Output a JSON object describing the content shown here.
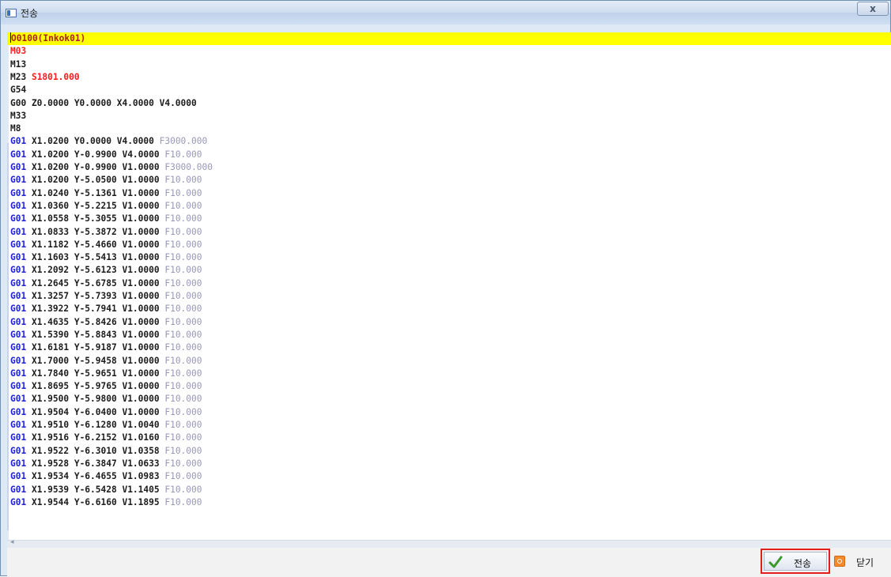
{
  "window": {
    "title": "전송",
    "close_glyph": "x"
  },
  "editor": {
    "lines": [
      [
        {
          "t": "O0100(Inkok01)",
          "c": "first"
        }
      ],
      [
        {
          "t": "M03",
          "c": "c-red"
        }
      ],
      [
        {
          "t": "M13",
          "c": "c-dark"
        }
      ],
      [
        {
          "t": "M23 ",
          "c": "c-dark"
        },
        {
          "t": "S1801.000",
          "c": "c-red"
        }
      ],
      [
        {
          "t": "G54",
          "c": "c-dark"
        }
      ],
      [
        {
          "t": "G00 Z0.0000 Y0.0000 X4.0000 V4.0000",
          "c": "c-dark"
        }
      ],
      [
        {
          "t": "M33",
          "c": "c-dark"
        }
      ],
      [
        {
          "t": "M8",
          "c": "c-dark"
        }
      ],
      [
        {
          "t": "G01",
          "c": "c-blue"
        },
        {
          "t": " X1.0200 Y0.0000 V4.0000 ",
          "c": "c-dark"
        },
        {
          "t": "F3000.000",
          "c": "c-feed"
        }
      ],
      [
        {
          "t": "G01",
          "c": "c-blue"
        },
        {
          "t": " X1.0200 Y-0.9900 V4.0000 ",
          "c": "c-dark"
        },
        {
          "t": "F10.000",
          "c": "c-feed"
        }
      ],
      [
        {
          "t": "G01",
          "c": "c-blue"
        },
        {
          "t": " X1.0200 Y-0.9900 V1.0000 ",
          "c": "c-dark"
        },
        {
          "t": "F3000.000",
          "c": "c-feed"
        }
      ],
      [
        {
          "t": "G01",
          "c": "c-blue"
        },
        {
          "t": " X1.0200 Y-5.0500 V1.0000 ",
          "c": "c-dark"
        },
        {
          "t": "F10.000",
          "c": "c-feed"
        }
      ],
      [
        {
          "t": "G01",
          "c": "c-blue"
        },
        {
          "t": " X1.0240 Y-5.1361 V1.0000 ",
          "c": "c-dark"
        },
        {
          "t": "F10.000",
          "c": "c-feed"
        }
      ],
      [
        {
          "t": "G01",
          "c": "c-blue"
        },
        {
          "t": " X1.0360 Y-5.2215 V1.0000 ",
          "c": "c-dark"
        },
        {
          "t": "F10.000",
          "c": "c-feed"
        }
      ],
      [
        {
          "t": "G01",
          "c": "c-blue"
        },
        {
          "t": " X1.0558 Y-5.3055 V1.0000 ",
          "c": "c-dark"
        },
        {
          "t": "F10.000",
          "c": "c-feed"
        }
      ],
      [
        {
          "t": "G01",
          "c": "c-blue"
        },
        {
          "t": " X1.0833 Y-5.3872 V1.0000 ",
          "c": "c-dark"
        },
        {
          "t": "F10.000",
          "c": "c-feed"
        }
      ],
      [
        {
          "t": "G01",
          "c": "c-blue"
        },
        {
          "t": " X1.1182 Y-5.4660 V1.0000 ",
          "c": "c-dark"
        },
        {
          "t": "F10.000",
          "c": "c-feed"
        }
      ],
      [
        {
          "t": "G01",
          "c": "c-blue"
        },
        {
          "t": " X1.1603 Y-5.5413 V1.0000 ",
          "c": "c-dark"
        },
        {
          "t": "F10.000",
          "c": "c-feed"
        }
      ],
      [
        {
          "t": "G01",
          "c": "c-blue"
        },
        {
          "t": " X1.2092 Y-5.6123 V1.0000 ",
          "c": "c-dark"
        },
        {
          "t": "F10.000",
          "c": "c-feed"
        }
      ],
      [
        {
          "t": "G01",
          "c": "c-blue"
        },
        {
          "t": " X1.2645 Y-5.6785 V1.0000 ",
          "c": "c-dark"
        },
        {
          "t": "F10.000",
          "c": "c-feed"
        }
      ],
      [
        {
          "t": "G01",
          "c": "c-blue"
        },
        {
          "t": " X1.3257 Y-5.7393 V1.0000 ",
          "c": "c-dark"
        },
        {
          "t": "F10.000",
          "c": "c-feed"
        }
      ],
      [
        {
          "t": "G01",
          "c": "c-blue"
        },
        {
          "t": " X1.3922 Y-5.7941 V1.0000 ",
          "c": "c-dark"
        },
        {
          "t": "F10.000",
          "c": "c-feed"
        }
      ],
      [
        {
          "t": "G01",
          "c": "c-blue"
        },
        {
          "t": " X1.4635 Y-5.8426 V1.0000 ",
          "c": "c-dark"
        },
        {
          "t": "F10.000",
          "c": "c-feed"
        }
      ],
      [
        {
          "t": "G01",
          "c": "c-blue"
        },
        {
          "t": " X1.5390 Y-5.8843 V1.0000 ",
          "c": "c-dark"
        },
        {
          "t": "F10.000",
          "c": "c-feed"
        }
      ],
      [
        {
          "t": "G01",
          "c": "c-blue"
        },
        {
          "t": " X1.6181 Y-5.9187 V1.0000 ",
          "c": "c-dark"
        },
        {
          "t": "F10.000",
          "c": "c-feed"
        }
      ],
      [
        {
          "t": "G01",
          "c": "c-blue"
        },
        {
          "t": " X1.7000 Y-5.9458 V1.0000 ",
          "c": "c-dark"
        },
        {
          "t": "F10.000",
          "c": "c-feed"
        }
      ],
      [
        {
          "t": "G01",
          "c": "c-blue"
        },
        {
          "t": " X1.7840 Y-5.9651 V1.0000 ",
          "c": "c-dark"
        },
        {
          "t": "F10.000",
          "c": "c-feed"
        }
      ],
      [
        {
          "t": "G01",
          "c": "c-blue"
        },
        {
          "t": " X1.8695 Y-5.9765 V1.0000 ",
          "c": "c-dark"
        },
        {
          "t": "F10.000",
          "c": "c-feed"
        }
      ],
      [
        {
          "t": "G01",
          "c": "c-blue"
        },
        {
          "t": " X1.9500 Y-5.9800 V1.0000 ",
          "c": "c-dark"
        },
        {
          "t": "F10.000",
          "c": "c-feed"
        }
      ],
      [
        {
          "t": "G01",
          "c": "c-blue"
        },
        {
          "t": " X1.9504 Y-6.0400 V1.0000 ",
          "c": "c-dark"
        },
        {
          "t": "F10.000",
          "c": "c-feed"
        }
      ],
      [
        {
          "t": "G01",
          "c": "c-blue"
        },
        {
          "t": " X1.9510 Y-6.1280 V1.0040 ",
          "c": "c-dark"
        },
        {
          "t": "F10.000",
          "c": "c-feed"
        }
      ],
      [
        {
          "t": "G01",
          "c": "c-blue"
        },
        {
          "t": " X1.9516 Y-6.2152 V1.0160 ",
          "c": "c-dark"
        },
        {
          "t": "F10.000",
          "c": "c-feed"
        }
      ],
      [
        {
          "t": "G01",
          "c": "c-blue"
        },
        {
          "t": " X1.9522 Y-6.3010 V1.0358 ",
          "c": "c-dark"
        },
        {
          "t": "F10.000",
          "c": "c-feed"
        }
      ],
      [
        {
          "t": "G01",
          "c": "c-blue"
        },
        {
          "t": " X1.9528 Y-6.3847 V1.0633 ",
          "c": "c-dark"
        },
        {
          "t": "F10.000",
          "c": "c-feed"
        }
      ],
      [
        {
          "t": "G01",
          "c": "c-blue"
        },
        {
          "t": " X1.9534 Y-6.4655 V1.0983 ",
          "c": "c-dark"
        },
        {
          "t": "F10.000",
          "c": "c-feed"
        }
      ],
      [
        {
          "t": "G01",
          "c": "c-blue"
        },
        {
          "t": " X1.9539 Y-6.5428 V1.1405 ",
          "c": "c-dark"
        },
        {
          "t": "F10.000",
          "c": "c-feed"
        }
      ],
      [
        {
          "t": "G01",
          "c": "c-blue"
        },
        {
          "t": " X1.9544 Y-6.6160 V1.1895 ",
          "c": "c-dark"
        },
        {
          "t": "F10.000",
          "c": "c-feed"
        }
      ]
    ]
  },
  "footer": {
    "send_label": "전송",
    "close_label": "닫기"
  },
  "colors": {
    "highlight_line": "#ffff00",
    "g_code": "#1f22d8",
    "m_s_code": "#ff1c1c",
    "feed": "#9897ba",
    "send_button_outline": "#e41c1c"
  }
}
